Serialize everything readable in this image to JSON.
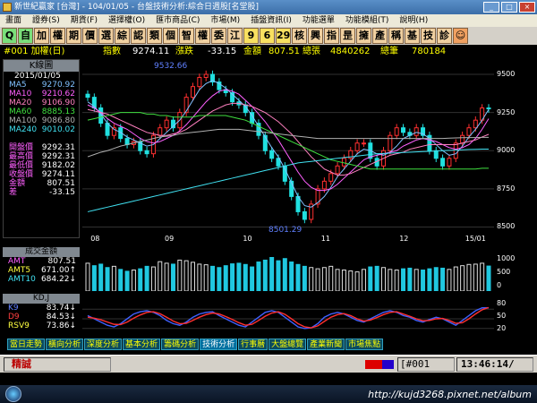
{
  "window": {
    "title": "新世紀贏家 [台灣] - 104/01/05 - 台盤技術分析:綜合日週股[名堂股]",
    "controls": [
      "_",
      "□",
      "×"
    ]
  },
  "menu": [
    "畫面",
    "證券(S)",
    "期貨(F)",
    "選擇權(O)",
    "匯市商品(C)",
    "市場(M)",
    "插盤資訊(I)",
    "功能選單",
    "功能模組(T)",
    "說明(H)"
  ],
  "toolbar": [
    {
      "label": "Q",
      "color": "g"
    },
    {
      "label": "自",
      "color": "g"
    },
    {
      "label": "加"
    },
    {
      "label": "權"
    },
    {
      "label": "期"
    },
    {
      "label": "價"
    },
    {
      "label": "選"
    },
    {
      "label": "綜"
    },
    {
      "label": "認"
    },
    {
      "label": "類"
    },
    {
      "label": "個"
    },
    {
      "label": "智"
    },
    {
      "label": "權"
    },
    {
      "label": "委"
    },
    {
      "label": "江"
    },
    {
      "label": "9",
      "color": "y"
    },
    {
      "label": "6",
      "color": "y"
    },
    {
      "label": "29",
      "color": "y"
    },
    {
      "label": "核"
    },
    {
      "label": "興"
    },
    {
      "label": "指"
    },
    {
      "label": "昰"
    },
    {
      "label": "擁"
    },
    {
      "label": "產"
    },
    {
      "label": "稱"
    },
    {
      "label": "基"
    },
    {
      "label": "技"
    },
    {
      "label": "診"
    },
    {
      "label": "☺",
      "color": "o"
    }
  ],
  "info": {
    "symbol": "#001 加權(日)",
    "index_label": "指數",
    "index_value": "9274.11",
    "change_label": "漲跌",
    "change_value": "-33.15",
    "amount_label": "金額",
    "amount_value": "807.51",
    "total_vol_label": "總張",
    "total_vol_value": "4840262",
    "total_trades_label": "總筆",
    "total_trades_value": "780184"
  },
  "legend": {
    "title": "K線圖",
    "date": "2015/01/05",
    "ma": [
      {
        "label": "MA5",
        "value": "9270.92",
        "color": "#80c0ff"
      },
      {
        "label": "MA10",
        "value": "9210.62",
        "color": "#ff60ff"
      },
      {
        "label": "MA20",
        "value": "9106.90",
        "color": "#ff80c0"
      },
      {
        "label": "MA60",
        "value": "8885.13",
        "color": "#40e040"
      },
      {
        "label": "MA100",
        "value": "9086.80",
        "color": "#b0b0b0"
      },
      {
        "label": "MA240",
        "value": "9010.02",
        "color": "#40e0f0"
      }
    ],
    "ohlc": [
      {
        "label": "開盤價",
        "value": "9292.31"
      },
      {
        "label": "最高價",
        "value": "9292.31"
      },
      {
        "label": "最低價",
        "value": "9182.02"
      },
      {
        "label": "收盤價",
        "value": "9274.11"
      },
      {
        "label": "金額",
        "value": "807.51"
      },
      {
        "label": "差",
        "value": "-33.15"
      }
    ]
  },
  "chart_annotations": {
    "high": "9532.66",
    "low": "8501.29"
  },
  "price_axis": [
    "9500",
    "9250",
    "9000",
    "8750",
    "8500"
  ],
  "date_axis": [
    "08",
    "09",
    "10",
    "11",
    "12",
    "15/01"
  ],
  "volume": {
    "title": "成交金額",
    "rows": [
      {
        "label": "AMT",
        "value": "807.51"
      },
      {
        "label": "AMT5",
        "value": "671.00↑"
      },
      {
        "label": "AMT10",
        "value": "684.22↓"
      }
    ],
    "axis": [
      "1000",
      "500",
      "0"
    ]
  },
  "kd": {
    "title": "KD,J",
    "rows": [
      {
        "label": "K9",
        "value": "83.74↓"
      },
      {
        "label": "D9",
        "value": "84.53↓"
      },
      {
        "label": "RSV9",
        "value": "73.86↓"
      }
    ],
    "axis": [
      "80",
      "50",
      "20"
    ]
  },
  "tabs": [
    "當日走勢",
    "橫向分析",
    "深度分析",
    "基本分析",
    "籌碼分析",
    "技術分析",
    "行事曆",
    "大盤總覽",
    "產業新聞",
    "市場焦點"
  ],
  "active_tab": 5,
  "status": {
    "left": "精誠",
    "code": "[#001",
    "time": "13:46:14/"
  },
  "watermark": "http://kujd3268.pixnet.net/album",
  "colors": {
    "up": "#ff3030",
    "down": "#20e0e0",
    "volume": "#20c8e0",
    "k_line": "#4060ff",
    "d_line": "#ff3030"
  },
  "chart_data": [
    {
      "type": "candlestick",
      "ylim": [
        8450,
        9600
      ],
      "x": [
        "08",
        "09",
        "10",
        "11",
        "12",
        "15/01"
      ],
      "y_ticks": [
        8500,
        8750,
        9000,
        9250,
        9500
      ],
      "close": [
        9350,
        9280,
        9180,
        9100,
        9150,
        9080,
        9040,
        9060,
        9000,
        8980,
        9100,
        9150,
        9200,
        9150,
        9250,
        9350,
        9420,
        9480,
        9500,
        9450,
        9400,
        9380,
        9320,
        9300,
        9250,
        9180,
        9100,
        9000,
        8950,
        8900,
        8800,
        8700,
        8600,
        8550,
        8650,
        8750,
        8800,
        8850,
        8900,
        8950,
        9000,
        9050,
        9050,
        8950,
        8900,
        9000,
        9100,
        9150,
        9120,
        9100,
        9150,
        9100,
        9000,
        8950,
        8900,
        8950,
        9050,
        9100,
        9150,
        9200,
        9280,
        9274
      ],
      "series": [
        {
          "name": "MA5",
          "values": [
            9320,
            9290,
            9240,
            9180,
            9140,
            9120,
            9090,
            9070,
            9050,
            9030,
            9040,
            9080,
            9120,
            9160,
            9200,
            9260,
            9330,
            9400,
            9440,
            9460,
            9440,
            9410,
            9370,
            9330,
            9290,
            9230,
            9160,
            9090,
            9020,
            8960,
            8880,
            8790,
            8700,
            8640,
            8630,
            8660,
            8700,
            8760,
            8830,
            8880,
            8930,
            8980,
            9010,
            9000,
            8980,
            8970,
            8990,
            9030,
            9080,
            9100,
            9120,
            9110,
            9080,
            9040,
            9000,
            8970,
            8980,
            9030,
            9090,
            9140,
            9200,
            9270
          ]
        },
        {
          "name": "MA10",
          "values": [
            9300,
            9280,
            9250,
            9210,
            9180,
            9160,
            9140,
            9110,
            9080,
            9060,
            9050,
            9060,
            9080,
            9100,
            9130,
            9170,
            9220,
            9270,
            9320,
            9360,
            9390,
            9400,
            9390,
            9370,
            9330,
            9290,
            9240,
            9190,
            9130,
            9070,
            9000,
            8930,
            8860,
            8800,
            8760,
            8740,
            8740,
            8750,
            8780,
            8820,
            8860,
            8900,
            8940,
            8960,
            8970,
            8980,
            8990,
            9000,
            9030,
            9050,
            9070,
            9080,
            9070,
            9060,
            9040,
            9020,
            9010,
            9020,
            9040,
            9080,
            9140,
            9210
          ]
        },
        {
          "name": "MA20",
          "values": [
            9270,
            9260,
            9250,
            9240,
            9220,
            9200,
            9180,
            9160,
            9140,
            9120,
            9110,
            9100,
            9100,
            9110,
            9120,
            9140,
            9170,
            9200,
            9230,
            9260,
            9280,
            9300,
            9310,
            9310,
            9300,
            9290,
            9270,
            9250,
            9220,
            9190,
            9150,
            9110,
            9060,
            9010,
            8960,
            8920,
            8880,
            8860,
            8840,
            8840,
            8850,
            8870,
            8890,
            8910,
            8930,
            8950,
            8970,
            8980,
            8990,
            9010,
            9020,
            9030,
            9040,
            9040,
            9040,
            9040,
            9040,
            9050,
            9060,
            9070,
            9090,
            9107
          ]
        },
        {
          "name": "MA60",
          "values": [
            9200,
            9210,
            9220,
            9230,
            9240,
            9250,
            9250,
            9250,
            9250,
            9240,
            9240,
            9230,
            9230,
            9220,
            9220,
            9220,
            9220,
            9230,
            9230,
            9230,
            9230,
            9230,
            9220,
            9210,
            9200,
            9180,
            9160,
            9140,
            9120,
            9100,
            9080,
            9060,
            9040,
            9020,
            9000,
            8980,
            8960,
            8940,
            8930,
            8920,
            8910,
            8900,
            8890,
            8880,
            8880,
            8880,
            8880,
            8880,
            8880,
            8880,
            8880,
            8880,
            8880,
            8880,
            8880,
            8880,
            8880,
            8880,
            8880,
            8880,
            8885,
            8885
          ]
        },
        {
          "name": "MA100",
          "values": [
            8960,
            8975,
            8990,
            9000,
            9015,
            9030,
            9040,
            9050,
            9060,
            9070,
            9080,
            9090,
            9095,
            9100,
            9110,
            9115,
            9120,
            9125,
            9130,
            9135,
            9140,
            9140,
            9140,
            9140,
            9135,
            9130,
            9125,
            9120,
            9115,
            9110,
            9105,
            9100,
            9095,
            9090,
            9085,
            9080,
            9080,
            9080,
            9080,
            9080,
            9080,
            9080,
            9080,
            9080,
            9080,
            9080,
            9080,
            9080,
            9080,
            9080,
            9080,
            9080,
            9080,
            9080,
            9080,
            9082,
            9084,
            9085,
            9086,
            9086,
            9087,
            9087
          ]
        },
        {
          "name": "MA240",
          "values": [
            8600,
            8610,
            8620,
            8630,
            8640,
            8650,
            8660,
            8670,
            8680,
            8690,
            8700,
            8710,
            8720,
            8730,
            8740,
            8750,
            8760,
            8770,
            8780,
            8790,
            8800,
            8810,
            8820,
            8830,
            8840,
            8850,
            8860,
            8870,
            8880,
            8890,
            8900,
            8910,
            8920,
            8925,
            8930,
            8935,
            8940,
            8945,
            8950,
            8955,
            8960,
            8965,
            8970,
            8975,
            8980,
            8982,
            8984,
            8986,
            8988,
            8990,
            8992,
            8994,
            8996,
            8998,
            9000,
            9002,
            9004,
            9006,
            9008,
            9009,
            9010,
            9010
          ]
        }
      ]
    },
    {
      "type": "bar",
      "title": "成交金額",
      "ylim": [
        0,
        1100
      ],
      "values": [
        900,
        820,
        870,
        760,
        800,
        700,
        640,
        680,
        720,
        800,
        780,
        950,
        900,
        870,
        1000,
        980,
        930,
        870,
        850,
        800,
        760,
        820,
        880,
        900,
        860,
        780,
        940,
        1000,
        1100,
        980,
        1050,
        940,
        860,
        800,
        760,
        720,
        760,
        800,
        700,
        680,
        650,
        620,
        700,
        780,
        800,
        760,
        700,
        680,
        720,
        740,
        700,
        680,
        720,
        760,
        740,
        700,
        780,
        820,
        860,
        870,
        900,
        808
      ]
    },
    {
      "type": "line",
      "title": "KD,J",
      "ylim": [
        0,
        100
      ],
      "series": [
        {
          "name": "K9",
          "values": [
            60,
            50,
            40,
            30,
            25,
            35,
            50,
            65,
            72,
            75,
            70,
            60,
            45,
            35,
            30,
            40,
            55,
            65,
            70,
            72,
            60,
            50,
            40,
            30,
            25,
            40,
            55,
            70,
            75,
            70,
            55,
            40,
            25,
            20,
            22,
            35,
            55,
            65,
            70,
            65,
            55,
            45,
            40,
            50,
            60,
            70,
            75,
            70,
            60,
            55,
            45,
            40,
            48,
            55,
            50,
            40,
            30,
            45,
            60,
            75,
            84,
            84
          ]
        },
        {
          "name": "D9",
          "values": [
            55,
            52,
            47,
            40,
            33,
            32,
            40,
            52,
            62,
            70,
            72,
            66,
            55,
            43,
            35,
            36,
            45,
            55,
            63,
            68,
            65,
            57,
            48,
            38,
            30,
            33,
            45,
            58,
            68,
            72,
            64,
            50,
            35,
            25,
            22,
            28,
            42,
            55,
            63,
            66,
            60,
            50,
            43,
            46,
            54,
            63,
            70,
            72,
            65,
            58,
            50,
            44,
            45,
            50,
            51,
            45,
            36,
            38,
            50,
            65,
            78,
            85
          ]
        }
      ]
    }
  ]
}
